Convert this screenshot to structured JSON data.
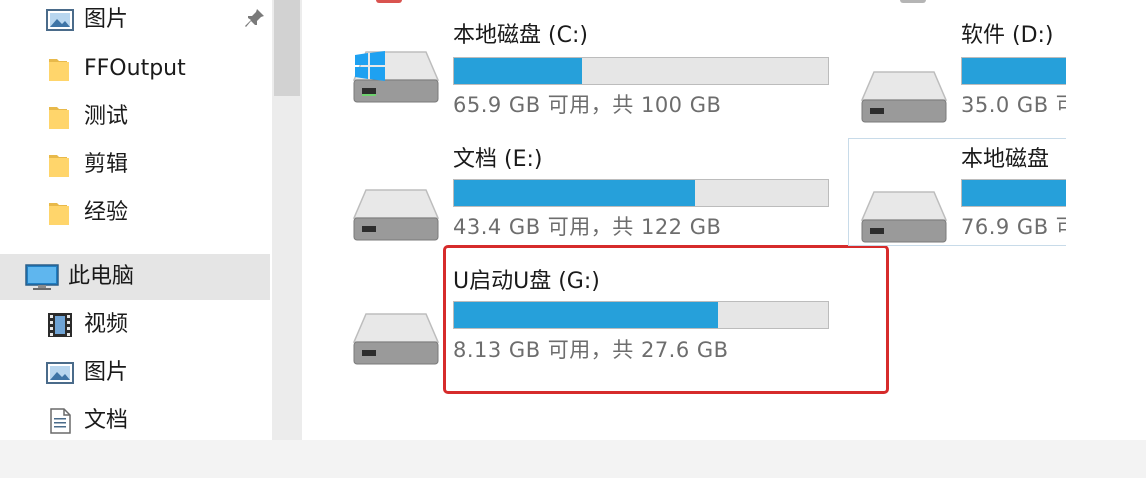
{
  "sidebar": {
    "items": [
      {
        "label": "图片",
        "icon": "pictures-icon",
        "pinned": true
      },
      {
        "label": "FFOutput",
        "icon": "folder-icon"
      },
      {
        "label": "测试",
        "icon": "folder-icon"
      },
      {
        "label": "剪辑",
        "icon": "folder-icon"
      },
      {
        "label": "经验",
        "icon": "folder-icon"
      },
      {
        "label": "此电脑",
        "icon": "this-pc-icon",
        "selected": true
      },
      {
        "label": "视频",
        "icon": "videos-icon"
      },
      {
        "label": "图片",
        "icon": "pictures-icon"
      },
      {
        "label": "文档",
        "icon": "documents-icon"
      }
    ]
  },
  "drives": [
    {
      "name": "本地磁盘 (C:)",
      "size_text": "65.9 GB 可用，共 100 GB",
      "used_fraction": 0.341,
      "windows_logo": true
    },
    {
      "name": "文档 (E:)",
      "size_text": "43.4 GB 可用，共 122 GB",
      "used_fraction": 0.644
    },
    {
      "name": "U启动U盘 (G:)",
      "size_text": "8.13 GB 可用，共 27.6 GB",
      "used_fraction": 0.705,
      "highlighted": true
    },
    {
      "name": "软件 (D:)",
      "size_text": "35.0 GB 可",
      "used_fraction": 0.7
    },
    {
      "name": "本地磁盘",
      "size_text": "76.9 GB 可",
      "used_fraction": 0.7
    }
  ],
  "colors": {
    "usage_bar": "#26a0da",
    "bar_background": "#e6e6e6",
    "highlight_border": "#d62b2b",
    "selected_nav": "#e5e5e5"
  }
}
